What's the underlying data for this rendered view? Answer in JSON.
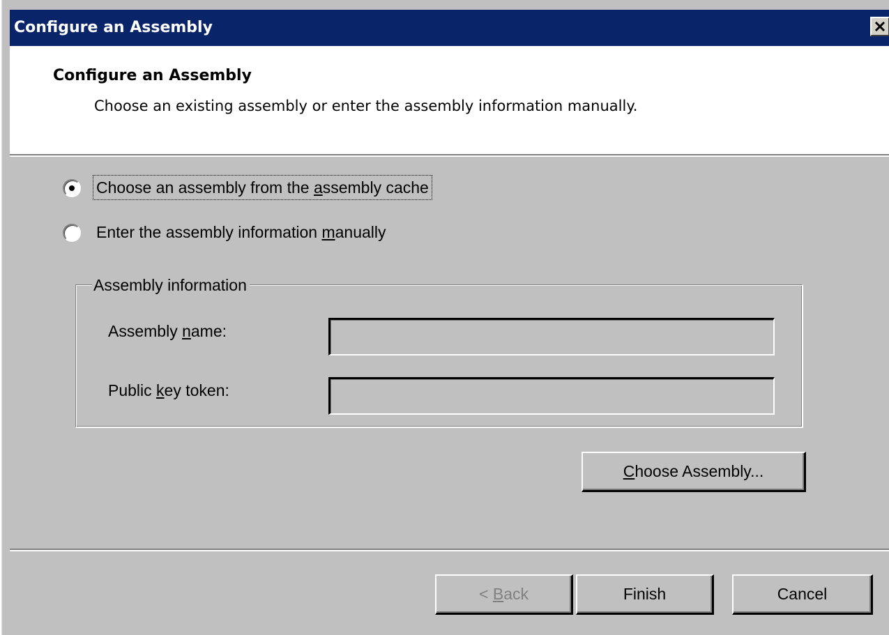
{
  "window": {
    "title": "Configure an Assembly",
    "close_icon": "close-icon"
  },
  "header": {
    "title": "Configure an Assembly",
    "subtitle": "Choose an existing assembly or enter the assembly information manually."
  },
  "options": {
    "selected": "cache",
    "cache": {
      "label_before": "Choose an assembly from the ",
      "label_mnemonic": "a",
      "label_after": "ssembly cache",
      "checked": true
    },
    "manual": {
      "label_before": "Enter the assembly information ",
      "label_mnemonic": "m",
      "label_after": "anually",
      "checked": false
    }
  },
  "assembly_info": {
    "legend": "Assembly information",
    "name_label_before": "Assembly ",
    "name_label_mnemonic": "n",
    "name_label_after": "ame:",
    "name_value": "",
    "token_label_before": "Public ",
    "token_label_mnemonic": "k",
    "token_label_after": "ey token:",
    "token_value": ""
  },
  "buttons": {
    "choose_mnemonic": "C",
    "choose_after": "hoose Assembly...",
    "back_before": "< ",
    "back_mnemonic": "B",
    "back_after": "ack",
    "finish": "Finish",
    "cancel": "Cancel"
  },
  "colors": {
    "titlebar": "#0a246a",
    "face": "#c0c0c0",
    "header_background": "#ffffff",
    "disabled_text": "#808080"
  }
}
